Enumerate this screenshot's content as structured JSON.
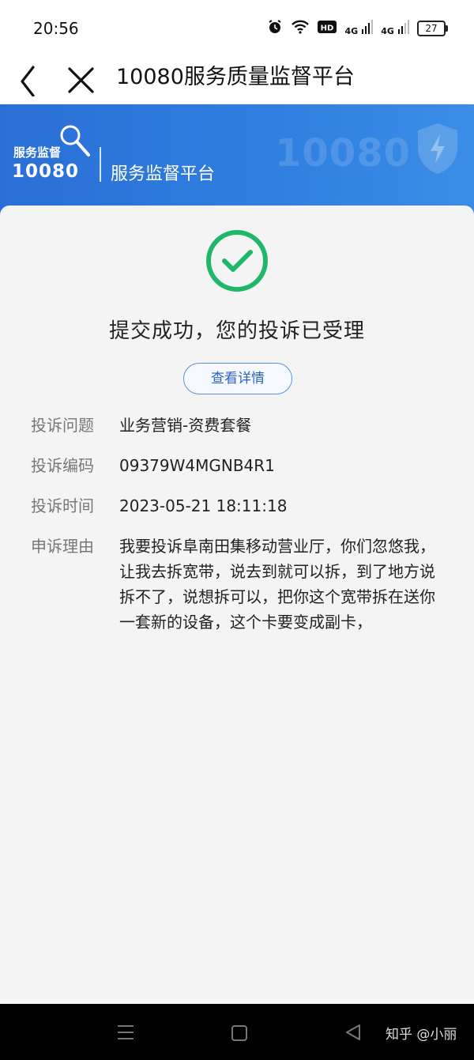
{
  "status_bar": {
    "time": "20:56",
    "icons": [
      "alarm-icon",
      "wifi-icon",
      "hd-icon",
      "signal-4g-icon",
      "signal-4g-icon",
      "battery-icon"
    ],
    "hd_label": "HD",
    "net1": "4G",
    "net2": "4G",
    "battery": "27"
  },
  "nav": {
    "title": "10080服务质量监督平台",
    "back_icon": "chevron-left-icon",
    "close_icon": "close-icon"
  },
  "banner": {
    "logo_top": "服务监督",
    "logo_num": "10080",
    "subtitle": "服务监督平台",
    "watermark": "10080",
    "colors": {
      "start": "#2a6fd6",
      "end": "#3b8de6"
    }
  },
  "result": {
    "success_text": "提交成功，您的投诉已受理",
    "detail_button": "查看详情",
    "success_color": "#1fb86a"
  },
  "info": {
    "issue_label": "投诉问题",
    "issue_value": "业务营销-资费套餐",
    "code_label": "投诉编码",
    "code_value": "09379W4MGNB4R1",
    "time_label": "投诉时间",
    "time_value": "2023-05-21 18:11:18",
    "reason_label": "申诉理由",
    "reason_value": "我要投诉阜南田集移动营业厅，你们忽悠我，让我去拆宽带，说去到就可以拆，到了地方说拆不了，说想拆可以，把你这个宽带拆在送你一套新的设备，这个卡要变成副卡，"
  },
  "system_nav": {
    "watermark": "知乎 @小丽"
  }
}
